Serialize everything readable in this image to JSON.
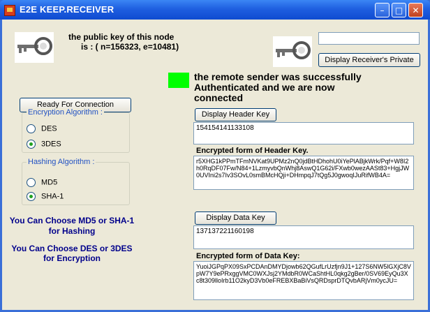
{
  "window": {
    "title": "E2E KEEP.RECEIVER",
    "minimize": "–",
    "maximize": "□",
    "close": "✕"
  },
  "public_key": {
    "line1": "the public key of this node",
    "line2": "is : ( n=156323,  e=10481)"
  },
  "private_key": {
    "input_value": "",
    "button_label": "Display Receiver's Private"
  },
  "connection": {
    "button_label": "Ready For Connection",
    "status_color": "#00ff00",
    "status_line1": "the remote sender was successfully",
    "status_line2": "Authenticated and we are now",
    "status_line3": "connected"
  },
  "encryption": {
    "group_title": "Encryption Algorithm :",
    "options": [
      "DES",
      "3DES"
    ],
    "selected": "3DES"
  },
  "hashing": {
    "group_title": "Hashing Algorithm :",
    "options": [
      "MD5",
      "SHA-1"
    ],
    "selected": "SHA-1"
  },
  "notes": {
    "hash_line1": "You Can Choose MD5 or SHA-1",
    "hash_line2": "for Hashing",
    "enc_line1": "You Can Choose DES or 3DES",
    "enc_line2": "for Encryption"
  },
  "header_key": {
    "button_label": "Display Header Key",
    "value": "154154141133108",
    "encrypted_label": "Encrypted form of  Header Key.",
    "encrypted_value": "r5XHG1kPPmTFmNVKat9UPMz2nQ0jdBtHDhohU0iYePlABjkWrk/Pqf+W8I2h0RqDF07Fw/N84+1LzmyvbQnWhj8AswQ1G62i/FXwb0wezAASt83+HgjJW0UVIni2s7Iv3SOvL0smBMcHQji+DHmpqJ7tQg5J0gwoqIJuRifWB4A="
  },
  "data_key": {
    "button_label": "Display Data Key",
    "value": "137137221160198",
    "encrypted_label": "Encrypted form of  Data Key:",
    "encrypted_value": "YuoiJGPqPX09SxPCDAnDMYDjowb62QGufLrUzfjn9J1+127S6NW5lGXjC8VpW7Y9ePRxggVMC0WXJsj2YMdbR0WCaShtHL0qkg2gBer/0SV69EyQu3Xc8t309lloIrb11O2kyD3Vb0eFREBXBaBiVsQRDsprDTQvbARjVm0ycJU="
  }
}
